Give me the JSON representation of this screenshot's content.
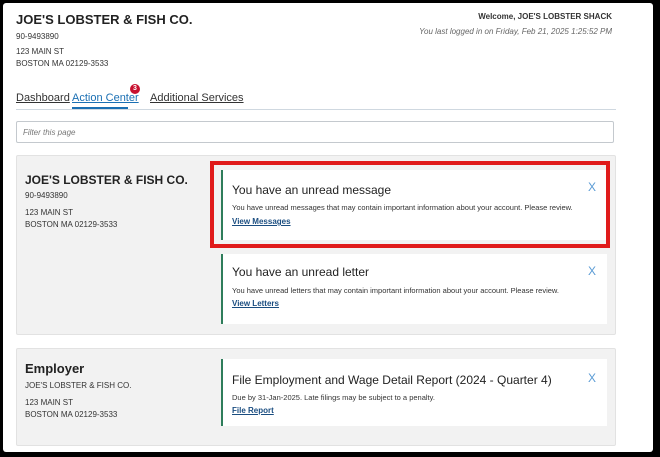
{
  "header": {
    "company_name": "JOE'S LOBSTER & FISH CO.",
    "account_id": "90-9493890",
    "address_line1": "123 MAIN ST",
    "address_line2": "BOSTON MA 02129-3533",
    "welcome": "Welcome, JOE'S LOBSTER SHACK",
    "last_login": "You last logged in on Friday, Feb 21, 2025 1:25:52 PM"
  },
  "tabs": {
    "dashboard": "Dashboard",
    "action_center": "Action Center",
    "action_center_badge": "3",
    "additional_services": "Additional Services"
  },
  "filter": {
    "placeholder": "Filter this page",
    "value": ""
  },
  "account_panel": {
    "name": "JOE'S LOBSTER & FISH CO.",
    "id": "90-9493890",
    "address_line1": "123 MAIN ST",
    "address_line2": "BOSTON MA 02129-3533",
    "cards": [
      {
        "title": "You have an unread message",
        "description": "You have unread messages that may contain important information about your account. Please review.",
        "link": "View Messages",
        "close": "X"
      },
      {
        "title": "You have an unread letter",
        "description": "You have unread letters that may contain important information about your account. Please review.",
        "link": "View Letters",
        "close": "X"
      }
    ]
  },
  "employer_panel": {
    "heading": "Employer",
    "name": "JOE'S LOBSTER & FISH CO.",
    "address_line1": "123 MAIN ST",
    "address_line2": "BOSTON MA 02129-3533",
    "card": {
      "title": "File Employment and Wage Detail Report (2024 - Quarter 4)",
      "description": "Due by 31-Jan-2025. Late filings may be subject to a penalty.",
      "link": "File Report",
      "close": "X"
    }
  },
  "colors": {
    "highlight_border": "#e01b1b",
    "accent_link": "#1a4d80",
    "badge": "#c8102e",
    "card_accent": "#2e7d5b"
  }
}
